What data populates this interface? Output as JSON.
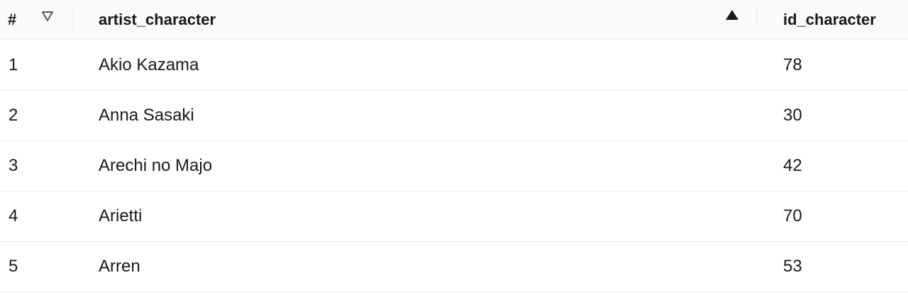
{
  "table": {
    "headers": {
      "index": "#",
      "artist": "artist_character",
      "id": "id_character"
    },
    "icons": {
      "filter": "filter-triangle-icon",
      "sort": "sort-ascending-icon"
    },
    "rows": [
      {
        "index": "1",
        "artist": "Akio Kazama",
        "id": "78"
      },
      {
        "index": "2",
        "artist": "Anna Sasaki",
        "id": "30"
      },
      {
        "index": "3",
        "artist": "Arechi no Majo",
        "id": "42"
      },
      {
        "index": "4",
        "artist": "Arietti",
        "id": "70"
      },
      {
        "index": "5",
        "artist": "Arren",
        "id": "53"
      }
    ]
  }
}
